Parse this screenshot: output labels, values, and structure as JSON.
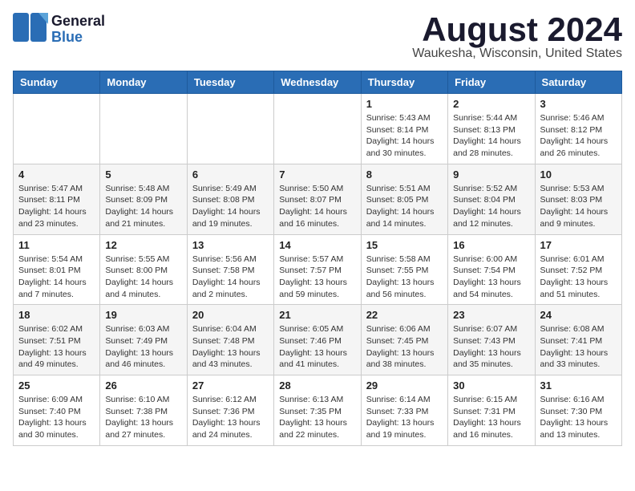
{
  "header": {
    "logo_line1": "General",
    "logo_line2": "Blue",
    "month": "August 2024",
    "location": "Waukesha, Wisconsin, United States"
  },
  "weekdays": [
    "Sunday",
    "Monday",
    "Tuesday",
    "Wednesday",
    "Thursday",
    "Friday",
    "Saturday"
  ],
  "weeks": [
    {
      "days": [
        {
          "num": "",
          "info": ""
        },
        {
          "num": "",
          "info": ""
        },
        {
          "num": "",
          "info": ""
        },
        {
          "num": "",
          "info": ""
        },
        {
          "num": "1",
          "info": "Sunrise: 5:43 AM\nSunset: 8:14 PM\nDaylight: 14 hours\nand 30 minutes."
        },
        {
          "num": "2",
          "info": "Sunrise: 5:44 AM\nSunset: 8:13 PM\nDaylight: 14 hours\nand 28 minutes."
        },
        {
          "num": "3",
          "info": "Sunrise: 5:46 AM\nSunset: 8:12 PM\nDaylight: 14 hours\nand 26 minutes."
        }
      ]
    },
    {
      "days": [
        {
          "num": "4",
          "info": "Sunrise: 5:47 AM\nSunset: 8:11 PM\nDaylight: 14 hours\nand 23 minutes."
        },
        {
          "num": "5",
          "info": "Sunrise: 5:48 AM\nSunset: 8:09 PM\nDaylight: 14 hours\nand 21 minutes."
        },
        {
          "num": "6",
          "info": "Sunrise: 5:49 AM\nSunset: 8:08 PM\nDaylight: 14 hours\nand 19 minutes."
        },
        {
          "num": "7",
          "info": "Sunrise: 5:50 AM\nSunset: 8:07 PM\nDaylight: 14 hours\nand 16 minutes."
        },
        {
          "num": "8",
          "info": "Sunrise: 5:51 AM\nSunset: 8:05 PM\nDaylight: 14 hours\nand 14 minutes."
        },
        {
          "num": "9",
          "info": "Sunrise: 5:52 AM\nSunset: 8:04 PM\nDaylight: 14 hours\nand 12 minutes."
        },
        {
          "num": "10",
          "info": "Sunrise: 5:53 AM\nSunset: 8:03 PM\nDaylight: 14 hours\nand 9 minutes."
        }
      ]
    },
    {
      "days": [
        {
          "num": "11",
          "info": "Sunrise: 5:54 AM\nSunset: 8:01 PM\nDaylight: 14 hours\nand 7 minutes."
        },
        {
          "num": "12",
          "info": "Sunrise: 5:55 AM\nSunset: 8:00 PM\nDaylight: 14 hours\nand 4 minutes."
        },
        {
          "num": "13",
          "info": "Sunrise: 5:56 AM\nSunset: 7:58 PM\nDaylight: 14 hours\nand 2 minutes."
        },
        {
          "num": "14",
          "info": "Sunrise: 5:57 AM\nSunset: 7:57 PM\nDaylight: 13 hours\nand 59 minutes."
        },
        {
          "num": "15",
          "info": "Sunrise: 5:58 AM\nSunset: 7:55 PM\nDaylight: 13 hours\nand 56 minutes."
        },
        {
          "num": "16",
          "info": "Sunrise: 6:00 AM\nSunset: 7:54 PM\nDaylight: 13 hours\nand 54 minutes."
        },
        {
          "num": "17",
          "info": "Sunrise: 6:01 AM\nSunset: 7:52 PM\nDaylight: 13 hours\nand 51 minutes."
        }
      ]
    },
    {
      "days": [
        {
          "num": "18",
          "info": "Sunrise: 6:02 AM\nSunset: 7:51 PM\nDaylight: 13 hours\nand 49 minutes."
        },
        {
          "num": "19",
          "info": "Sunrise: 6:03 AM\nSunset: 7:49 PM\nDaylight: 13 hours\nand 46 minutes."
        },
        {
          "num": "20",
          "info": "Sunrise: 6:04 AM\nSunset: 7:48 PM\nDaylight: 13 hours\nand 43 minutes."
        },
        {
          "num": "21",
          "info": "Sunrise: 6:05 AM\nSunset: 7:46 PM\nDaylight: 13 hours\nand 41 minutes."
        },
        {
          "num": "22",
          "info": "Sunrise: 6:06 AM\nSunset: 7:45 PM\nDaylight: 13 hours\nand 38 minutes."
        },
        {
          "num": "23",
          "info": "Sunrise: 6:07 AM\nSunset: 7:43 PM\nDaylight: 13 hours\nand 35 minutes."
        },
        {
          "num": "24",
          "info": "Sunrise: 6:08 AM\nSunset: 7:41 PM\nDaylight: 13 hours\nand 33 minutes."
        }
      ]
    },
    {
      "days": [
        {
          "num": "25",
          "info": "Sunrise: 6:09 AM\nSunset: 7:40 PM\nDaylight: 13 hours\nand 30 minutes."
        },
        {
          "num": "26",
          "info": "Sunrise: 6:10 AM\nSunset: 7:38 PM\nDaylight: 13 hours\nand 27 minutes."
        },
        {
          "num": "27",
          "info": "Sunrise: 6:12 AM\nSunset: 7:36 PM\nDaylight: 13 hours\nand 24 minutes."
        },
        {
          "num": "28",
          "info": "Sunrise: 6:13 AM\nSunset: 7:35 PM\nDaylight: 13 hours\nand 22 minutes."
        },
        {
          "num": "29",
          "info": "Sunrise: 6:14 AM\nSunset: 7:33 PM\nDaylight: 13 hours\nand 19 minutes."
        },
        {
          "num": "30",
          "info": "Sunrise: 6:15 AM\nSunset: 7:31 PM\nDaylight: 13 hours\nand 16 minutes."
        },
        {
          "num": "31",
          "info": "Sunrise: 6:16 AM\nSunset: 7:30 PM\nDaylight: 13 hours\nand 13 minutes."
        }
      ]
    }
  ]
}
